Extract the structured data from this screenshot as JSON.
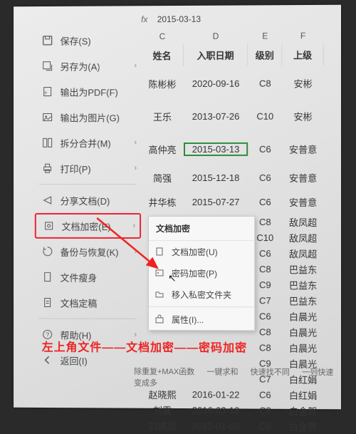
{
  "formula": {
    "fx": "fx",
    "value": "2015-03-13"
  },
  "columns": {
    "c": "C",
    "d": "D",
    "e": "E",
    "f": "F"
  },
  "headers": {
    "name": "姓名",
    "date": "入职日期",
    "level": "级别",
    "superior": "上级"
  },
  "rows": [
    {
      "name": "陈彬彬",
      "date": "2020-09-16",
      "level": "C8",
      "sup": "安彬"
    },
    {
      "name": "王乐",
      "date": "2013-07-26",
      "level": "C10",
      "sup": "安彬"
    },
    {
      "name": "高仲亮",
      "date": "2015-03-13",
      "level": "C6",
      "sup": "安普意"
    },
    {
      "name": "简强",
      "date": "2015-12-18",
      "level": "C6",
      "sup": "安普意"
    },
    {
      "name": "井华栋",
      "date": "2015-07-27",
      "level": "C6",
      "sup": "安普意"
    }
  ],
  "tail": [
    {
      "level": "C8",
      "sup": "敌凤超"
    },
    {
      "level": "C10",
      "sup": "敌凤超"
    },
    {
      "level": "C6",
      "sup": "敌凤超"
    },
    {
      "level": "C8",
      "sup": "巴益东"
    },
    {
      "level": "C9",
      "sup": "巴益东"
    },
    {
      "level": "C7",
      "sup": "巴益东"
    },
    {
      "level": "C6",
      "sup": "白晨光"
    },
    {
      "level": "C8",
      "sup": "白晨光"
    },
    {
      "level": "C8",
      "sup": "白晨光"
    },
    {
      "level": "C9",
      "sup": "白晨光"
    },
    {
      "level": "C7",
      "sup": "白红娟"
    }
  ],
  "lower_rows": [
    {
      "name": "赵晓熙",
      "date": "2016-01-22",
      "level": "C6",
      "sup": "白红娟"
    },
    {
      "name": "刘露",
      "date": "2016-03-18",
      "level": "C8",
      "sup": "白金贺"
    },
    {
      "name": "刘建超",
      "date": "2015-01-05",
      "level": "C9",
      "sup": "白金贺"
    }
  ],
  "menu": {
    "save": "保存(S)",
    "saveas": "另存为(A)",
    "pdf": "输出为PDF(F)",
    "img": "输出为图片(G)",
    "split": "拆分合并(M)",
    "print": "打印(P)",
    "share": "分享文档(D)",
    "encrypt": "文档加密(E)",
    "backup": "备份与恢复(K)",
    "slim": "文件瘦身",
    "loc": "文档定稿",
    "help": "帮助(H)",
    "back": "返回(I)"
  },
  "submenu": {
    "header": "文档加密",
    "doc": "文档加密(U)",
    "pwd": "密码加密(P)",
    "priv": "移入私密文件夹",
    "attr": "属性(I)..."
  },
  "caption": "左上角文件——文档加密——密码加密",
  "footer": {
    "a": "除重复+MAX函数",
    "b": "一键求和",
    "c": "快速找不同",
    "d": "一列快速变成多"
  }
}
